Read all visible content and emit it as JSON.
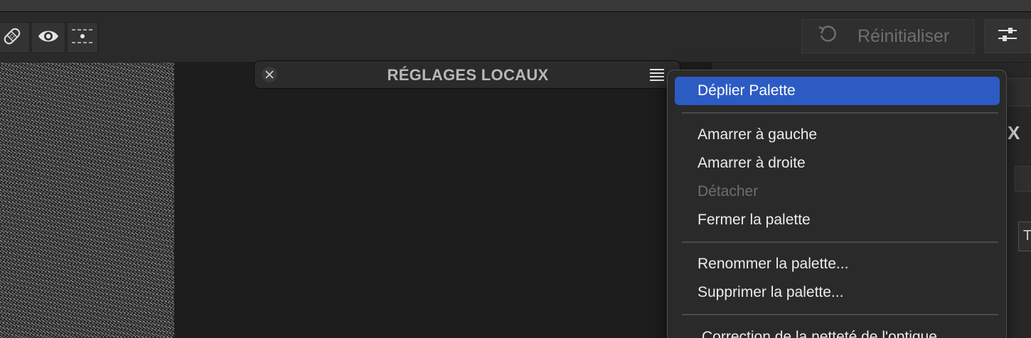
{
  "toolbar": {
    "reset_label": "Réinitialiser"
  },
  "palette": {
    "title": "RÉGLAGES LOCAUX"
  },
  "menu": {
    "items": [
      {
        "label": "Déplier Palette",
        "state": "highlighted"
      },
      {
        "label": "Amarrer à gauche",
        "state": "enabled"
      },
      {
        "label": "Amarrer à droite",
        "state": "enabled"
      },
      {
        "label": "Détacher",
        "state": "disabled"
      },
      {
        "label": "Fermer la palette",
        "state": "enabled"
      },
      {
        "label": "Renommer la palette...",
        "state": "enabled"
      },
      {
        "label": "Supprimer la palette...",
        "state": "enabled"
      },
      {
        "label": "Correction de la netteté de l'optique",
        "state": "enabled"
      }
    ]
  },
  "right_panel": {
    "x_label": "X",
    "t_label": "T"
  },
  "colors": {
    "menu_highlight": "#2c5bc4",
    "background": "#1e1e1e",
    "panel": "#2b2b2b"
  }
}
